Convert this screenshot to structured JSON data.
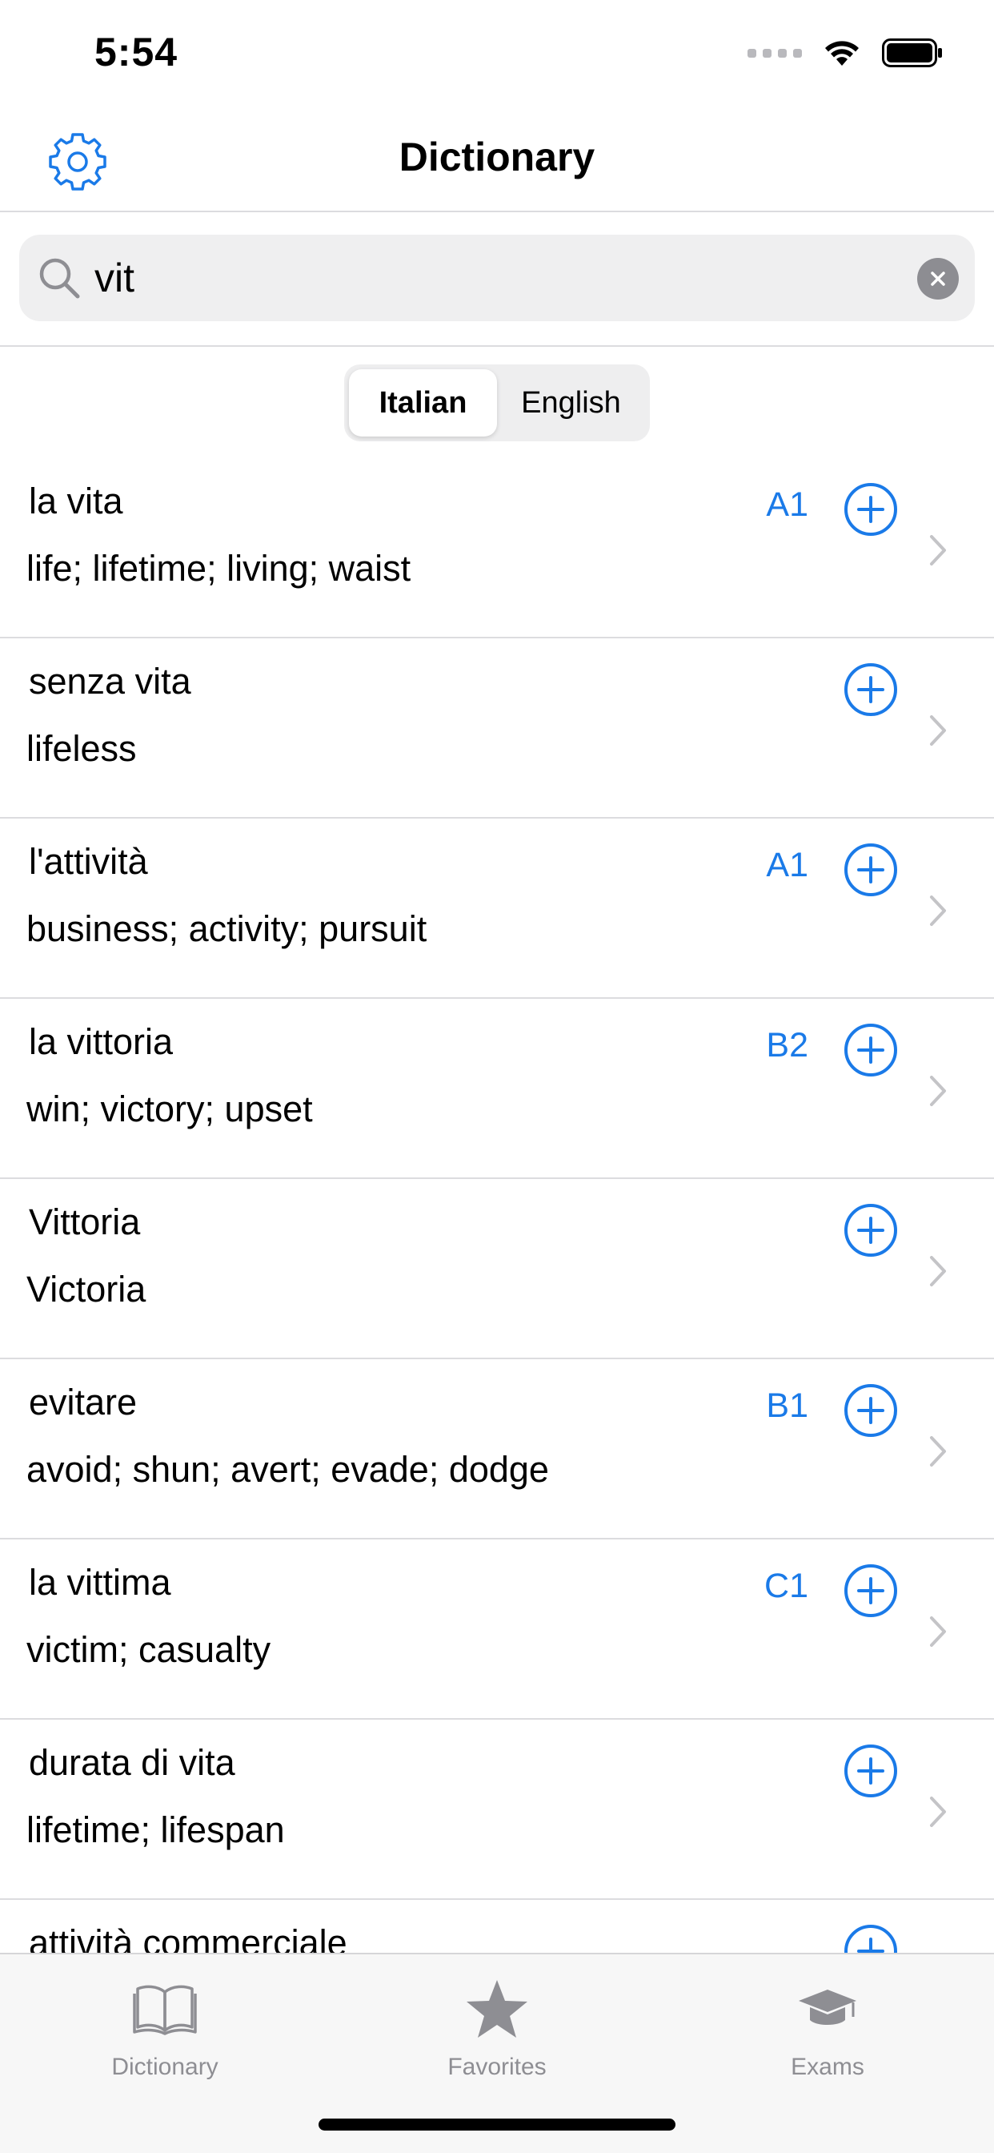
{
  "status_bar": {
    "time": "5:54",
    "signal_icon": "cellular-dots-icon",
    "wifi_icon": "wifi-icon",
    "battery_icon": "battery-icon"
  },
  "nav": {
    "title": "Dictionary",
    "settings_icon": "gear-icon"
  },
  "search": {
    "value": "vit",
    "placeholder": "Search",
    "icon": "magnifier-icon",
    "clear_icon": "clear-icon"
  },
  "segmented": {
    "options": [
      "Italian",
      "English"
    ],
    "selected": "Italian"
  },
  "colors": {
    "accent": "#1a7ae8",
    "separator": "#dcdcdf",
    "chevron": "#c4c4c7",
    "tab_inactive": "#8e8e93"
  },
  "results": [
    {
      "term": "la vita",
      "translation": "life; lifetime; living; waist",
      "level": "A1"
    },
    {
      "term": "senza vita",
      "translation": "lifeless",
      "level": ""
    },
    {
      "term": "l'attività",
      "translation": "business; activity; pursuit",
      "level": "A1"
    },
    {
      "term": "la vittoria",
      "translation": "win; victory; upset",
      "level": "B2"
    },
    {
      "term": "Vittoria",
      "translation": "Victoria",
      "level": ""
    },
    {
      "term": "evitare",
      "translation": "avoid; shun; avert; evade; dodge",
      "level": "B1"
    },
    {
      "term": "la vittima",
      "translation": "victim; casualty",
      "level": "C1"
    },
    {
      "term": "durata di vita",
      "translation": "lifetime; lifespan",
      "level": ""
    },
    {
      "term": "attività commerciale",
      "translation": "",
      "level": ""
    }
  ],
  "tabs": [
    {
      "label": "Dictionary",
      "icon": "open-book-icon"
    },
    {
      "label": "Favorites",
      "icon": "star-icon"
    },
    {
      "label": "Exams",
      "icon": "graduation-cap-icon"
    }
  ]
}
